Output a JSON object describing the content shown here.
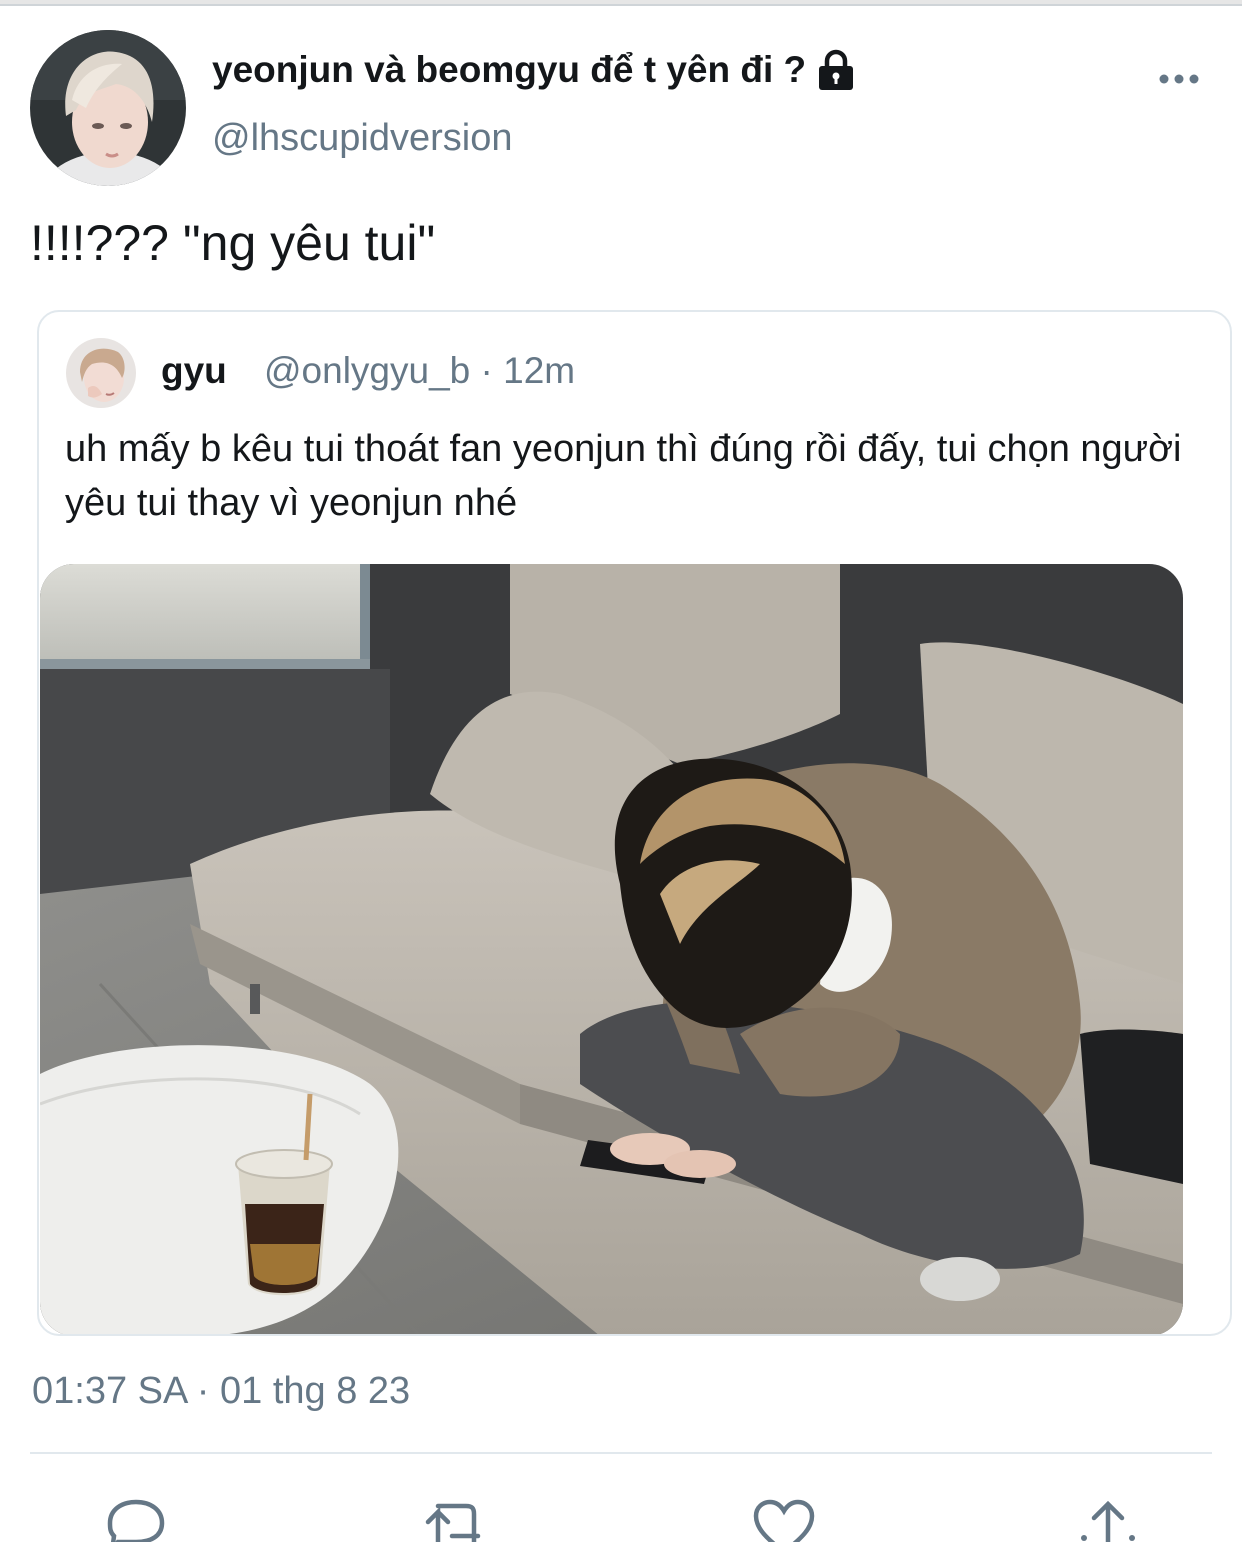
{
  "tweet": {
    "display_name": "yeonjun và beomgyu để t yên đi ?",
    "handle": "@lhscupidversion",
    "text": "!!!!??? \"ng yêu tui\"",
    "timestamp": "01:37 SA · 01 thg 8 23"
  },
  "quote": {
    "name": "gyu",
    "meta": "@onlygyu_b · 12m",
    "text": "uh mấy b kêu tui thoát fan yeonjun thì đúng rồi đấy, tui chọn người yêu tui thay vì yeonjun nhé"
  },
  "icons": {
    "lock": "lock-icon",
    "more": "more-dots-icon",
    "reply": "reply-icon",
    "retweet": "retweet-icon",
    "like": "heart-icon",
    "share": "share-icon"
  },
  "colors": {
    "text": "#14171a",
    "secondary": "#657786",
    "border": "#e1e8ed"
  }
}
